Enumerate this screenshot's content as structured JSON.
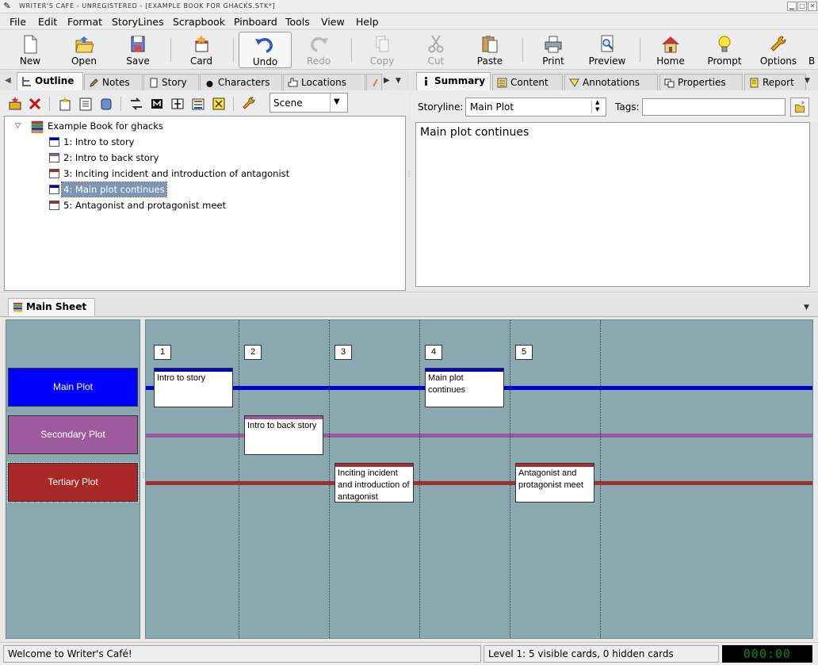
{
  "window": {
    "title": "WRITER'S CAFÉ - UNREGISTERED - [EXAMPLE BOOK FOR GHACKS.STK*]"
  },
  "menu": [
    "File",
    "Edit",
    "Format",
    "StoryLines",
    "Scrapbook",
    "Pinboard",
    "Tools",
    "View",
    "Help"
  ],
  "toolbar": {
    "new": "New",
    "open": "Open",
    "save": "Save",
    "card": "Card",
    "undo": "Undo",
    "redo": "Redo",
    "copy": "Copy",
    "cut": "Cut",
    "paste": "Paste",
    "print": "Print",
    "preview": "Preview",
    "home": "Home",
    "prompt": "Prompt",
    "options": "Options",
    "overflow": "B"
  },
  "left_tabs": [
    "Outline",
    "Notes",
    "Story",
    "Characters",
    "Locations"
  ],
  "outline": {
    "scope": "Scene",
    "book": "Example Book for ghacks",
    "scenes": [
      {
        "label": "1: Intro to story",
        "color": "#0000cc"
      },
      {
        "label": "2: Intro to back story",
        "color": "#9a5a9a"
      },
      {
        "label": "3: Inciting incident and introduction of antagonist",
        "color": "#b02828"
      },
      {
        "label": "4: Main plot continues",
        "color": "#0000cc"
      },
      {
        "label": "5: Antagonist and protagonist meet",
        "color": "#b02828"
      }
    ]
  },
  "right_tabs": [
    "Summary",
    "Content",
    "Annotations",
    "Properties",
    "Report"
  ],
  "summary": {
    "storyline_label": "Storyline:",
    "storyline_value": "Main Plot",
    "tags_label": "Tags:",
    "tags_value": "",
    "text": "Main plot continues"
  },
  "sheet": {
    "tab": "Main Sheet",
    "lanes": [
      {
        "name": "Main Plot",
        "color": "#0000ff",
        "line": "#0000cc"
      },
      {
        "name": "Secondary Plot",
        "color": "#9d5b9d",
        "line": "#9a5a9a"
      },
      {
        "name": "Tertiary Plot",
        "color": "#a82828",
        "line": "#a03030"
      }
    ],
    "columns": [
      "1",
      "2",
      "3",
      "4",
      "5"
    ],
    "cards": [
      {
        "text": "Intro to story",
        "lane": 0,
        "column": 0
      },
      {
        "text": "Intro to back story",
        "lane": 1,
        "column": 1
      },
      {
        "text": "Inciting incident and introduction of antagonist",
        "lane": 2,
        "column": 2
      },
      {
        "text": "Main plot continues",
        "lane": 0,
        "column": 3
      },
      {
        "text": "Antagonist and protagonist meet",
        "lane": 2,
        "column": 4
      }
    ]
  },
  "status": {
    "message": "Welcome to Writer's Café!",
    "cards": "Level 1: 5 visible cards, 0 hidden cards",
    "clock": "000:00"
  }
}
